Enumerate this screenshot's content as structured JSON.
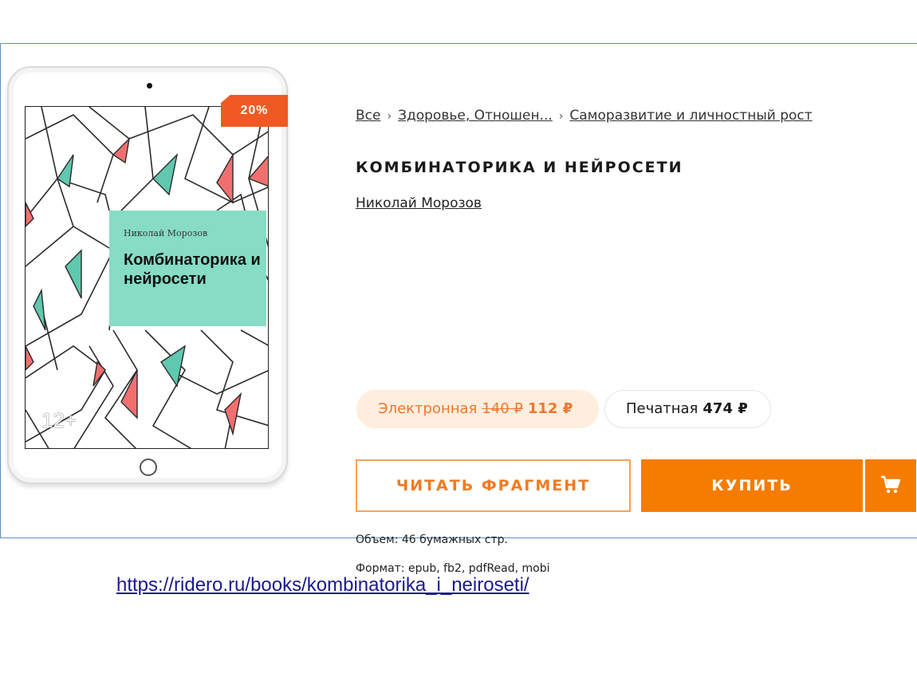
{
  "product": {
    "discount_badge": "20%",
    "breadcrumb": [
      "Все",
      "Здоровье, Отношен...",
      "Саморазвитие и личностный рост"
    ],
    "breadcrumb_separator": "›",
    "title": "КОМБИНАТОРИКА И НЕЙРОСЕТИ",
    "author": "Николай Морозов",
    "cover": {
      "author": "Николай Морозов",
      "title": "Комбинаторика и нейросети",
      "age_rating": "12+",
      "box_color": "#86dcc4",
      "accent_red": "#f07070",
      "accent_teal": "#5fc8ae"
    },
    "prices": {
      "ebook": {
        "label": "Электронная",
        "old_price": "140 ₽",
        "new_price": "112 ₽"
      },
      "print": {
        "label": "Печатная",
        "price": "474 ₽"
      }
    },
    "buttons": {
      "read_fragment": "ЧИТАТЬ ФРАГМЕНТ",
      "buy": "КУПИТЬ",
      "cart_icon": "cart-icon"
    },
    "details": {
      "volume": "Объем: 46 бумажных стр.",
      "format": "Формат: epub, fb2, pdfRead, mobi"
    }
  },
  "caption": {
    "url": "https://ridero.ru/books/kombinatorika_i_neiroseti/"
  },
  "colors": {
    "accent_orange": "#f57c00",
    "badge_orange": "#f05a22",
    "frame_border": "#5b8fc7"
  }
}
